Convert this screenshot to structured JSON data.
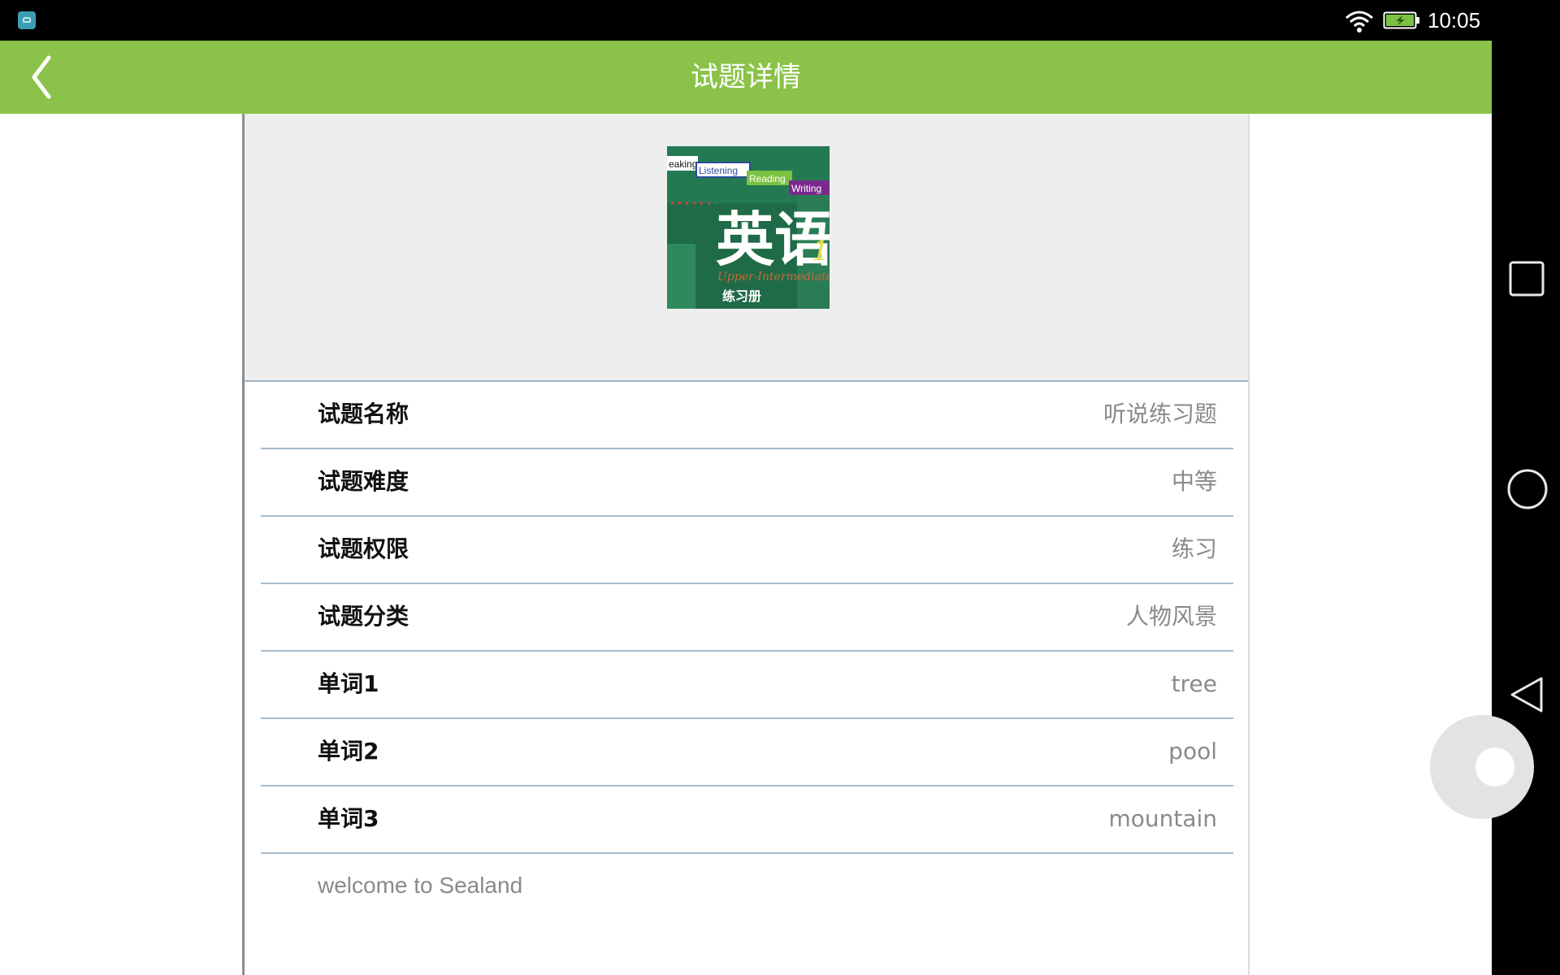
{
  "status_bar": {
    "time": "10:05",
    "icons": [
      "app-notification-icon",
      "wifi-icon",
      "battery-charging-icon"
    ]
  },
  "header": {
    "title": "试题详情",
    "back_icon": "chevron-left-icon"
  },
  "cover": {
    "tags": [
      "eaking",
      "Listening",
      "Reading",
      "Writing"
    ],
    "title": "英语",
    "number": "1",
    "subtitle": "Upper-Intermediate",
    "caption": "练习册"
  },
  "details": [
    {
      "label": "试题名称",
      "value": "听说练习题"
    },
    {
      "label": "试题难度",
      "value": "中等"
    },
    {
      "label": "试题权限",
      "value": "练习"
    },
    {
      "label": "试题分类",
      "value": "人物风景"
    },
    {
      "label": "单词1",
      "value": "tree"
    },
    {
      "label": "单词2",
      "value": "pool"
    },
    {
      "label": "单词3",
      "value": "mountain"
    }
  ],
  "description": "welcome to Sealand",
  "nav_bar": {
    "icons": [
      "recent-apps-icon",
      "home-icon",
      "back-icon"
    ]
  },
  "colors": {
    "accent": "#8bc34a",
    "divider": "#a9bccd",
    "value_text": "#8a8a8a"
  }
}
